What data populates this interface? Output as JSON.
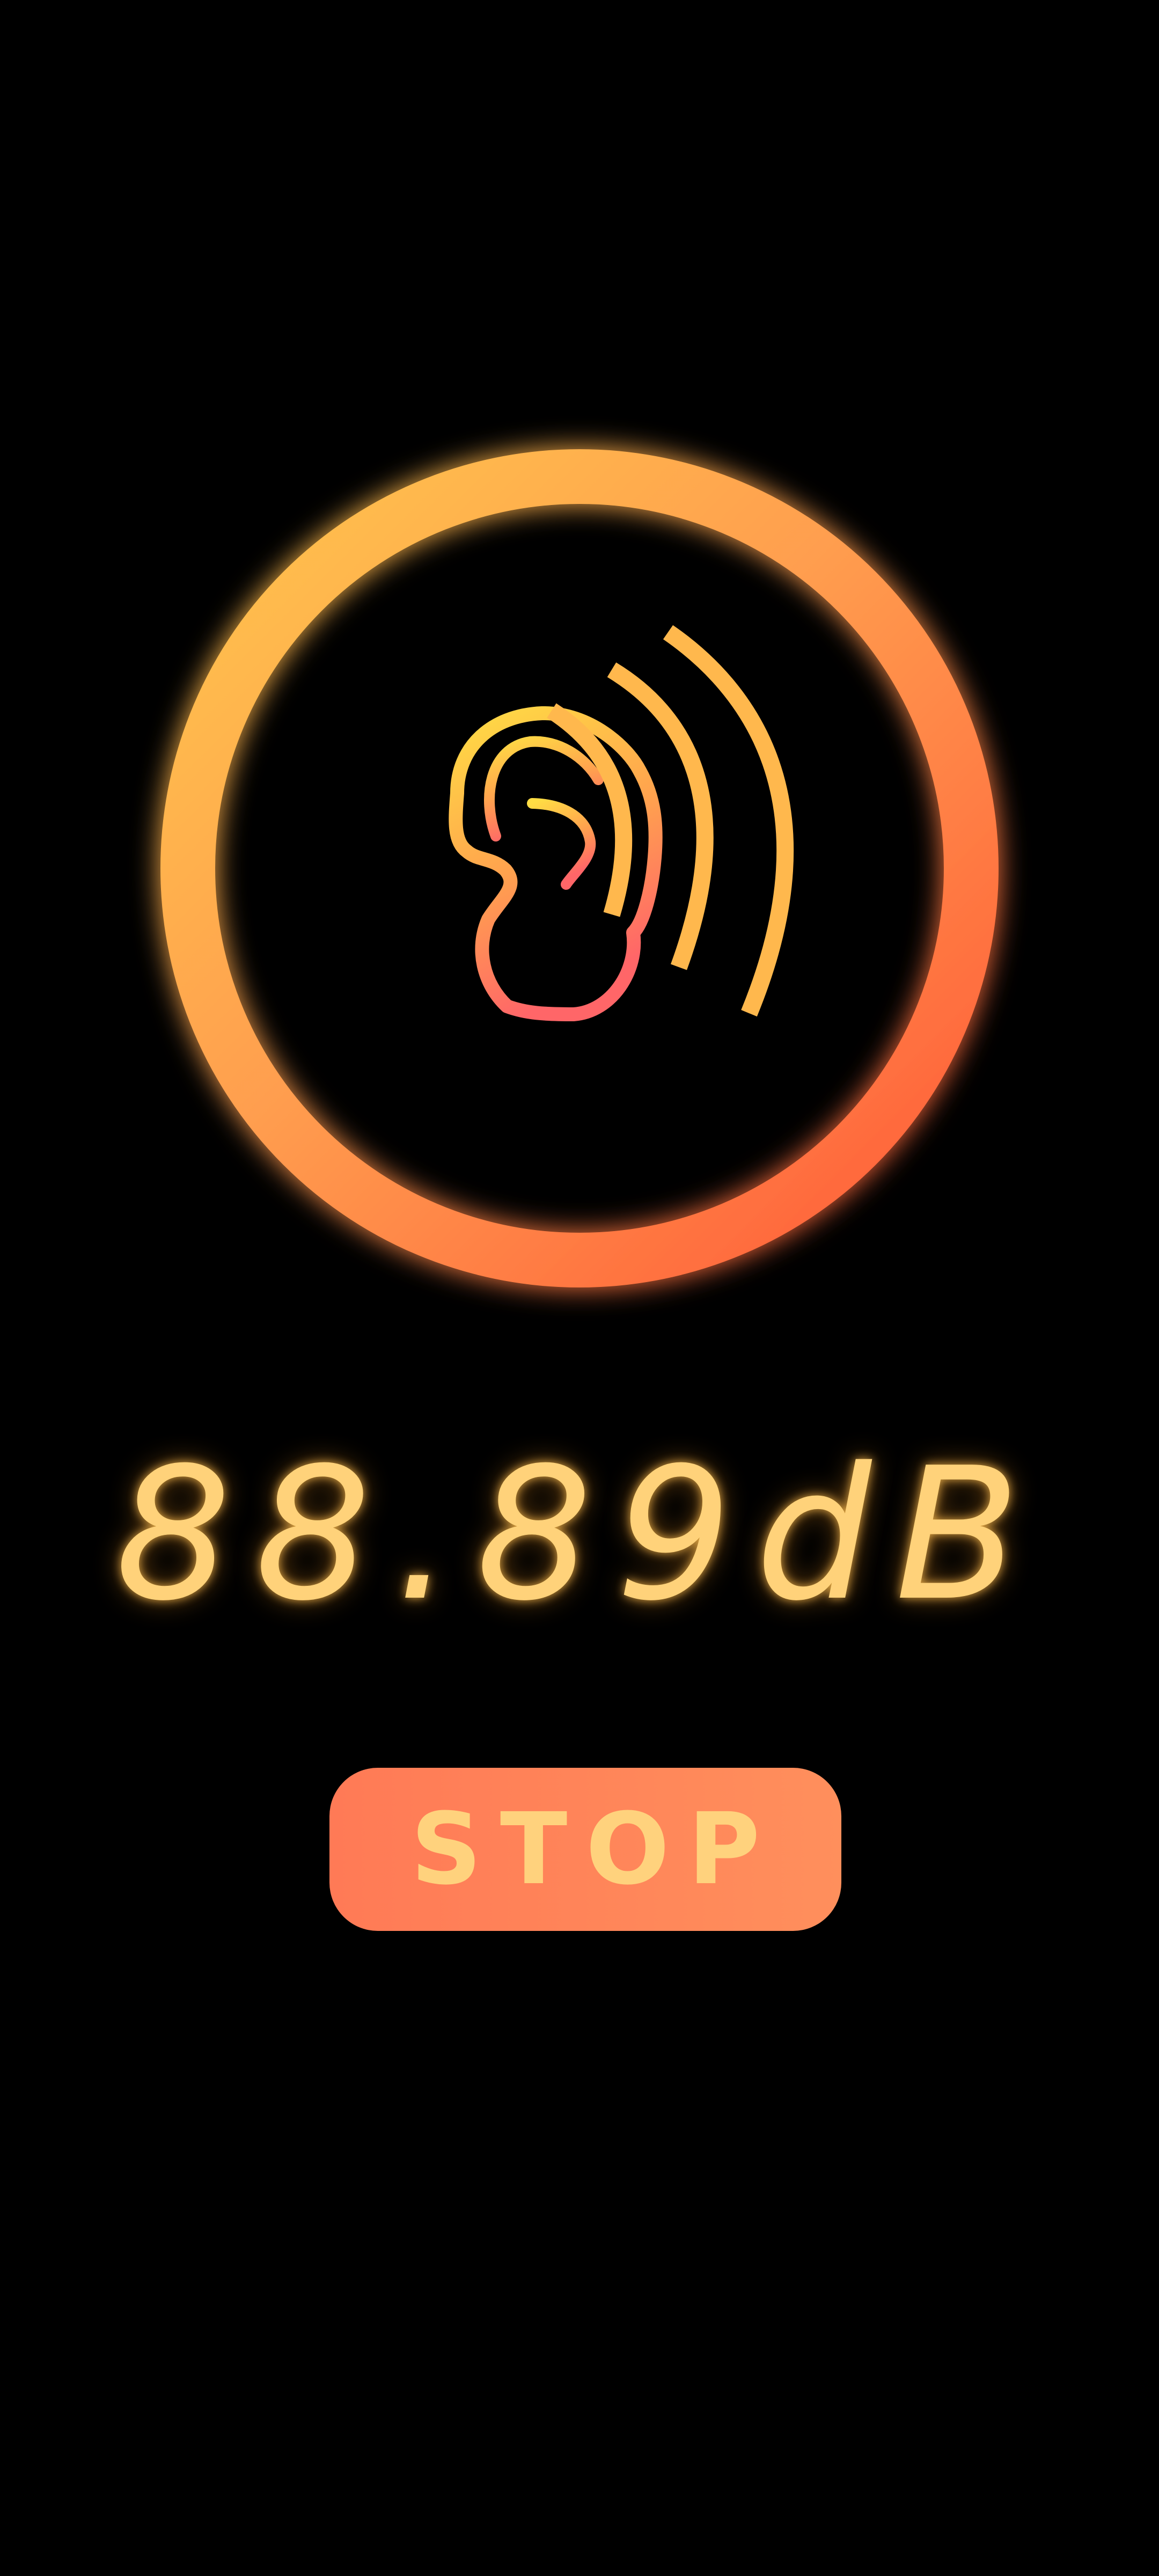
{
  "meter": {
    "icon": "ear-with-sound-waves-icon",
    "ring_gradient": [
      "#ffc24d",
      "#ff9e4f",
      "#ff5e3a"
    ],
    "ear_gradient": [
      "#ffd84a",
      "#ff6b6b"
    ],
    "waves_color": "#ffb84d",
    "glow_color": "#ffaa22"
  },
  "readout": {
    "value": "88.89dB",
    "color": "#ffd27a"
  },
  "controls": {
    "stop_label": "STOP",
    "button_color": "#ff8559",
    "label_color": "#ffd27d"
  }
}
